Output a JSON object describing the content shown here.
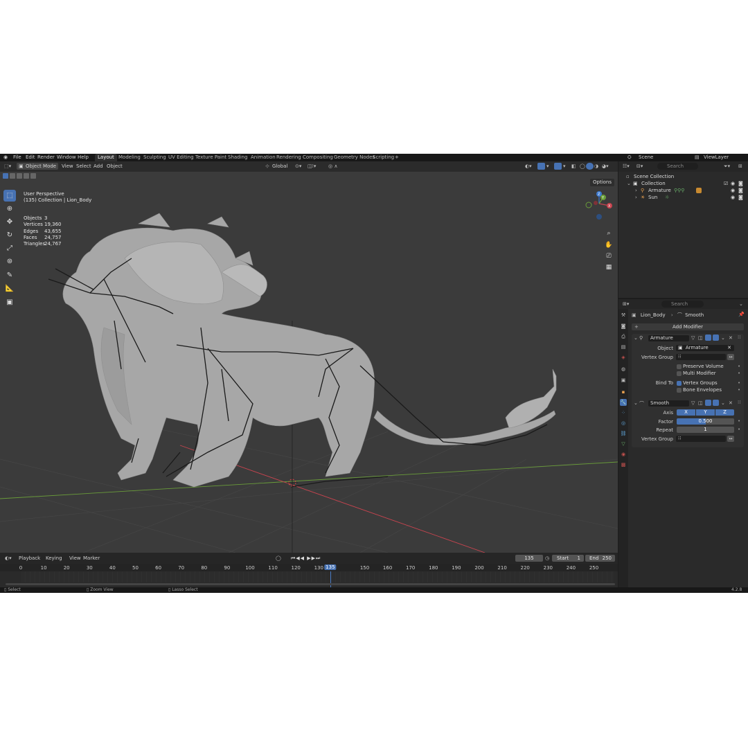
{
  "app": {
    "menus": [
      "File",
      "Edit",
      "Render",
      "Window",
      "Help"
    ],
    "workspaces": [
      "Layout",
      "Modeling",
      "Sculpting",
      "UV Editing",
      "Texture Paint",
      "Shading",
      "Animation",
      "Rendering",
      "Compositing",
      "Geometry Nodes",
      "Scripting"
    ],
    "active_workspace": "Layout",
    "add_tab": "+",
    "scene": "Scene",
    "view_layer": "ViewLayer"
  },
  "viewport": {
    "mode": "Object Mode",
    "menus": [
      "View",
      "Select",
      "Add",
      "Object"
    ],
    "transform_orientation": "Global",
    "options_label": "Options",
    "perspective": "User Perspective",
    "collection_info": "(135) Collection | Lion_Body",
    "stats": [
      {
        "label": "Objects",
        "value": "3"
      },
      {
        "label": "Vertices",
        "value": "19,360"
      },
      {
        "label": "Edges",
        "value": "43,655"
      },
      {
        "label": "Faces",
        "value": "24,757"
      },
      {
        "label": "Triangles",
        "value": "24,767"
      }
    ],
    "gizmo_axes": {
      "x": "X",
      "y": "Y",
      "z": "Z"
    }
  },
  "timeline": {
    "menus": [
      "Playback",
      "Keying",
      "View",
      "Marker"
    ],
    "current_frame": "135",
    "start_label": "Start",
    "start_value": "1",
    "end_label": "End",
    "end_value": "250",
    "ticks": [
      "0",
      "10",
      "20",
      "30",
      "40",
      "50",
      "60",
      "70",
      "80",
      "90",
      "100",
      "110",
      "120",
      "130",
      "135",
      "150",
      "160",
      "170",
      "180",
      "190",
      "200",
      "210",
      "220",
      "230",
      "240",
      "250"
    ]
  },
  "statusbar": {
    "select": "Select",
    "zoom": "Zoom View",
    "lasso": "Lasso Select",
    "version": "4.2.8"
  },
  "outliner": {
    "search_placeholder": "Search",
    "scene_collection": "Scene Collection",
    "collection": "Collection",
    "items": [
      {
        "name": "Armature",
        "icon": "armature-icon"
      },
      {
        "name": "Sun",
        "icon": "sun-icon"
      }
    ]
  },
  "properties": {
    "search_placeholder": "Search",
    "object_name": "Lion_Body",
    "modifier_crumb": "Smooth",
    "add_modifier": "Add Modifier",
    "armature_modifier": {
      "name": "Armature",
      "object_label": "Object",
      "object_value": "Armature",
      "vertex_group_label": "Vertex Group",
      "preserve_volume": "Preserve Volume",
      "multi_modifier": "Multi Modifier",
      "bind_to_label": "Bind To",
      "vertex_groups": "Vertex Groups",
      "bone_envelopes": "Bone Envelopes"
    },
    "smooth_modifier": {
      "name": "Smooth",
      "axis_label": "Axis",
      "axes": [
        "X",
        "Y",
        "Z"
      ],
      "factor_label": "Factor",
      "factor_value": "0.500",
      "repeat_label": "Repeat",
      "repeat_value": "1",
      "vertex_group_label": "Vertex Group"
    }
  },
  "colors": {
    "accent": "#4772b3",
    "viewport_bg": "#3b3b3b",
    "panel_bg": "#2a2a2a",
    "x_axis": "#c8444f",
    "y_axis": "#6a9d3a",
    "z_axis": "#3d7ad0"
  }
}
